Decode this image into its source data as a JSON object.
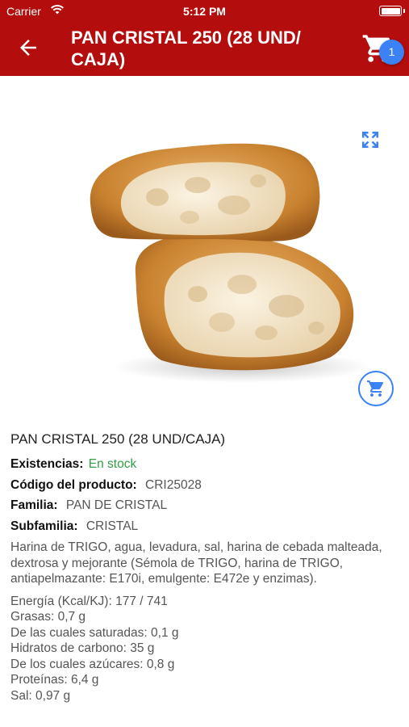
{
  "status_bar": {
    "carrier": "Carrier",
    "time": "5:12 PM"
  },
  "header": {
    "title": "PAN CRISTAL 250 (28 UND/ CAJA)",
    "cart_count": "1"
  },
  "colors": {
    "header_bg": "#b30d0d",
    "accent": "#3b82f6",
    "in_stock": "#2f9e44"
  },
  "icons": [
    "back-arrow-icon",
    "cart-icon",
    "expand-icon",
    "add-to-cart-icon",
    "wifi-icon",
    "battery-icon"
  ],
  "product": {
    "name": "PAN CRISTAL 250 (28 UND/CAJA)",
    "stock_label": "Existencias:",
    "stock_value": "En stock",
    "code_label": "Código del producto:",
    "code_value": "CRI25028",
    "family_label": "Familia:",
    "family_value": "PAN DE CRISTAL",
    "subfamily_label": "Subfamilia:",
    "subfamily_value": "CRISTAL",
    "description": "Harina de TRIGO, agua, levadura, sal, harina de cebada malteada, dextrosa y mejorante (Sémola de TRIGO, harina de TRIGO, antiapelmazante: E170i, emulgente: E472e y enzimas).",
    "nutrition": [
      "Energía (Kcal/KJ): 177 / 741",
      "Grasas: 0,7 g",
      "De las cuales saturadas: 0,1 g",
      "Hidratos de carbono: 35 g",
      "De los cuales azúcares: 0,8 g",
      "Proteínas: 6,4 g",
      "Sal: 0,97 g"
    ]
  }
}
